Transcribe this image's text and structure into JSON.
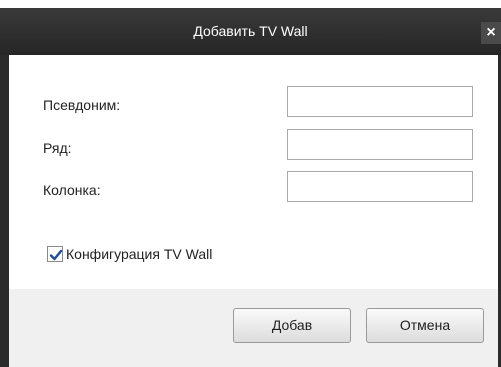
{
  "window": {
    "title": "Добавить TV Wall",
    "close_glyph": "×"
  },
  "form": {
    "alias_label": "Псевдоним:",
    "alias_value": "",
    "row_label": "Ряд:",
    "row_value": "",
    "column_label": "Колонка:",
    "column_value": "",
    "config_checkbox_label": "Конфигурация TV Wall",
    "config_checked": true
  },
  "buttons": {
    "add_label": "Добав",
    "cancel_label": "Отмена"
  },
  "colors": {
    "titlebar": "#2b2b2b",
    "checkmark": "#1f4e9c"
  }
}
